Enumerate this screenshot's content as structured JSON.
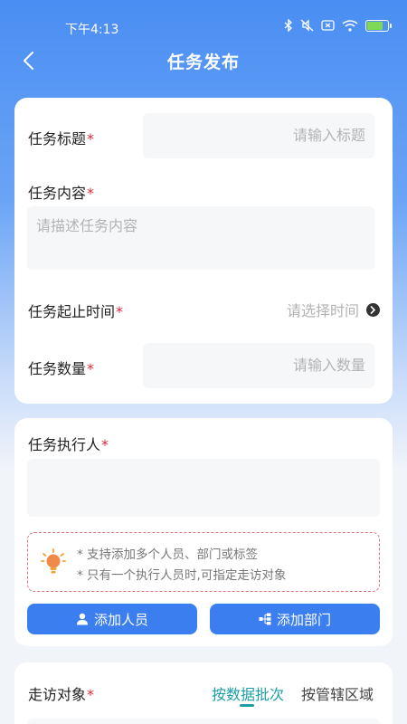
{
  "status_bar": {
    "time": "下午4:13"
  },
  "header": {
    "title": "任务发布"
  },
  "form": {
    "required_mark": "*",
    "task_title": {
      "label": "任务标题",
      "placeholder": "请输入标题"
    },
    "task_content": {
      "label": "任务内容",
      "placeholder": "请描述任务内容"
    },
    "task_time": {
      "label": "任务起止时间",
      "placeholder": "请选择时间"
    },
    "task_quantity": {
      "label": "任务数量",
      "placeholder": "请输入数量"
    }
  },
  "executor": {
    "label": "任务执行人",
    "tips": [
      "* 支持添加多个人员、部门或标签",
      "* 只有一个执行人员时,可指定走访对象"
    ],
    "add_person_label": "添加人员",
    "add_department_label": "添加部门"
  },
  "visit_target": {
    "label": "走访对象",
    "tabs": [
      {
        "label": "按数据批次",
        "active": true
      },
      {
        "label": "按管辖区域",
        "active": false
      }
    ]
  },
  "colors": {
    "primary": "#3a7ef0",
    "required": "#d9293b",
    "active_tab": "#1b9ea5"
  }
}
